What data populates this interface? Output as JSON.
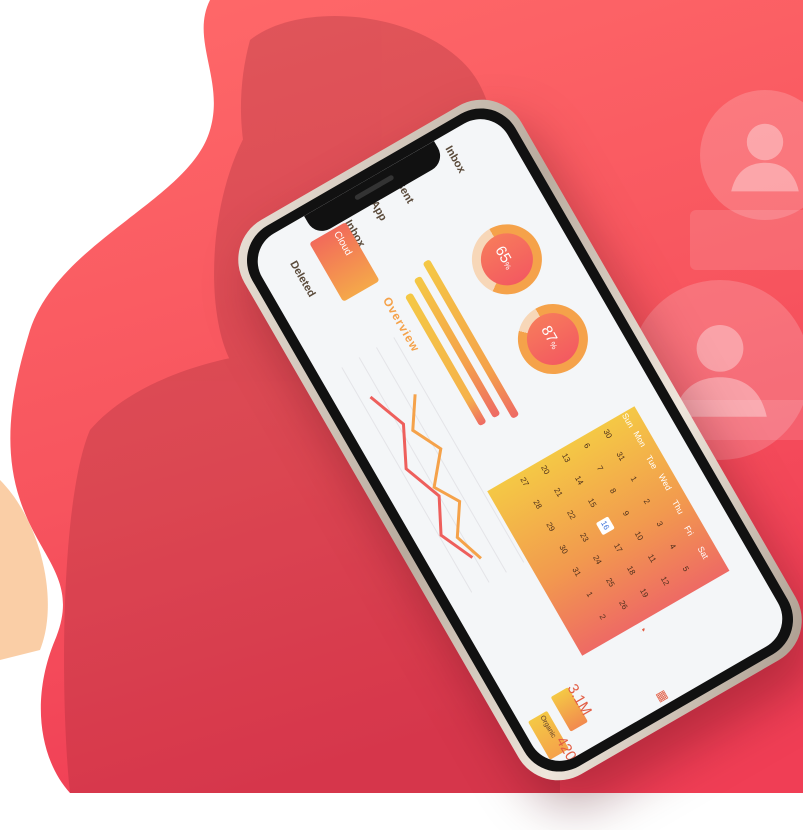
{
  "menu": {
    "items": [
      "Inbox",
      "Sent",
      "App",
      "Inbox",
      "Cloud",
      "Deleted"
    ]
  },
  "rings": [
    {
      "value": "65",
      "unit": "%",
      "fraction": 0.65
    },
    {
      "value": "87",
      "unit": "%",
      "fraction": 0.87
    }
  ],
  "overview": {
    "title": "Overview"
  },
  "calendar": {
    "weekdays": [
      "Sun",
      "Mon",
      "Tue",
      "Wed",
      "Thu",
      "Fri",
      "Sat"
    ],
    "rows": [
      [
        "30",
        "31",
        "1",
        "2",
        "3",
        "4",
        "5"
      ],
      [
        "6",
        "7",
        "8",
        "9",
        "10",
        "11",
        "12"
      ],
      [
        "13",
        "14",
        "15",
        "16",
        "17",
        "18",
        "19"
      ],
      [
        "20",
        "21",
        "22",
        "23",
        "24",
        "25",
        "26"
      ],
      [
        "27",
        "28",
        "29",
        "30",
        "31",
        "1",
        "2"
      ]
    ],
    "selected": "16"
  },
  "stats": [
    {
      "value": "3.1M",
      "label": ""
    },
    {
      "value": "420K",
      "label": "Organic"
    }
  ],
  "colors": {
    "accent_red": "#f24a5a",
    "accent_orange": "#f5a24a",
    "accent_yellow": "#f4c845"
  },
  "icons": {
    "clock": "clock-icon",
    "calendar": "calendar-icon",
    "avatar": "user-avatar-icon"
  }
}
